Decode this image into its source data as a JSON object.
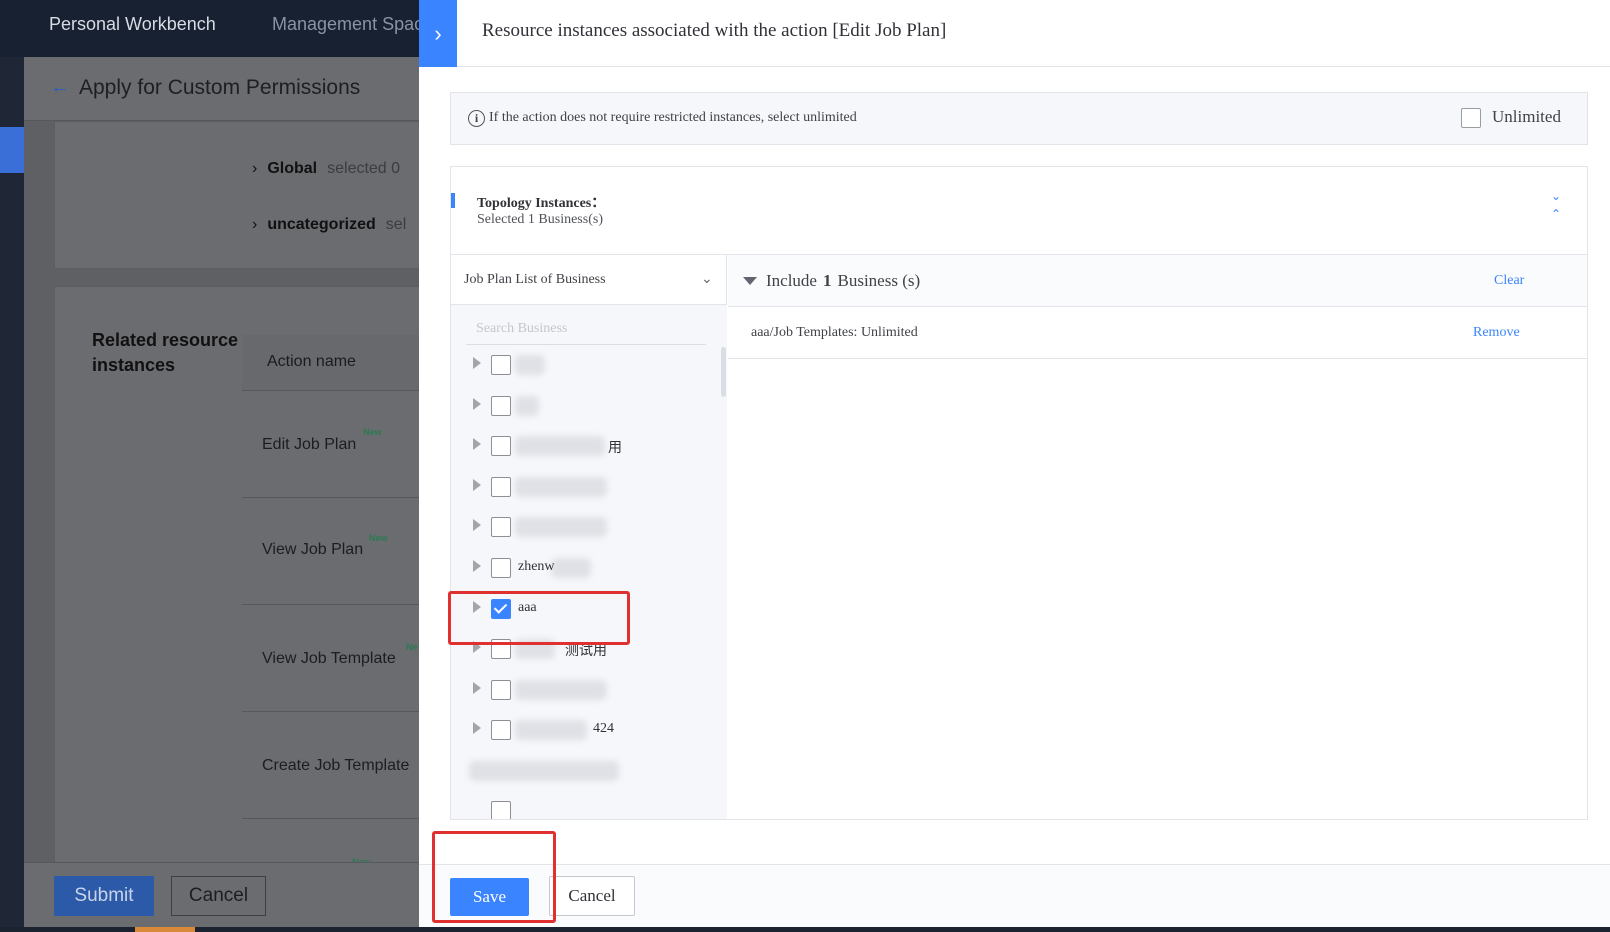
{
  "topbar": {
    "nav": [
      "Personal Workbench",
      "Management Space"
    ]
  },
  "page": {
    "title": "Apply for Custom Permissions",
    "groups": [
      {
        "name": "Global",
        "selected": "selected 0"
      },
      {
        "name": "uncategorized",
        "selected": "sel"
      }
    ],
    "related_title": "Related resource instances",
    "table_header": "Action name",
    "actions": [
      {
        "name": "Edit Job Plan",
        "badge": "New"
      },
      {
        "name": "View Job Plan",
        "badge": "New"
      },
      {
        "name": "View Job Template",
        "badge": "Ne"
      },
      {
        "name": "Create Job Template",
        "badge": ""
      }
    ],
    "extra_badge": "New",
    "submit_label": "Submit",
    "cancel_label": "Cancel"
  },
  "drawer": {
    "toggle_icon": "chevron-right-icon",
    "title": "Resource instances associated with the action [Edit Job Plan]",
    "info_text": "If the action does not require restricted instances, select unlimited",
    "unlimited_label": "Unlimited",
    "unlimited_checked": false,
    "topology": {
      "title": "Topology Instances：",
      "subtitle": "Selected 1 Business(s)"
    },
    "list_select": "Job Plan List of Business",
    "search_placeholder": "Search Business",
    "tree_items": [
      {
        "label": "",
        "checked": false
      },
      {
        "label": "",
        "checked": false
      },
      {
        "label": "用",
        "checked": false
      },
      {
        "label": "",
        "checked": false
      },
      {
        "label": "",
        "checked": false
      },
      {
        "label": "zhenw",
        "checked": false
      },
      {
        "label": "aaa",
        "checked": true
      },
      {
        "label": "测试用",
        "checked": false
      },
      {
        "label": "",
        "checked": false
      },
      {
        "label": "424",
        "checked": false
      }
    ],
    "include": {
      "prefix": "Include",
      "count": "1",
      "suffix": "Business (s)"
    },
    "clear_label": "Clear",
    "included_item": "aaa/Job Templates: Unlimited",
    "remove_label": "Remove",
    "save_label": "Save",
    "cancel_label": "Cancel",
    "highlight_color": "#e03131",
    "accent_color": "#3a84ff"
  }
}
